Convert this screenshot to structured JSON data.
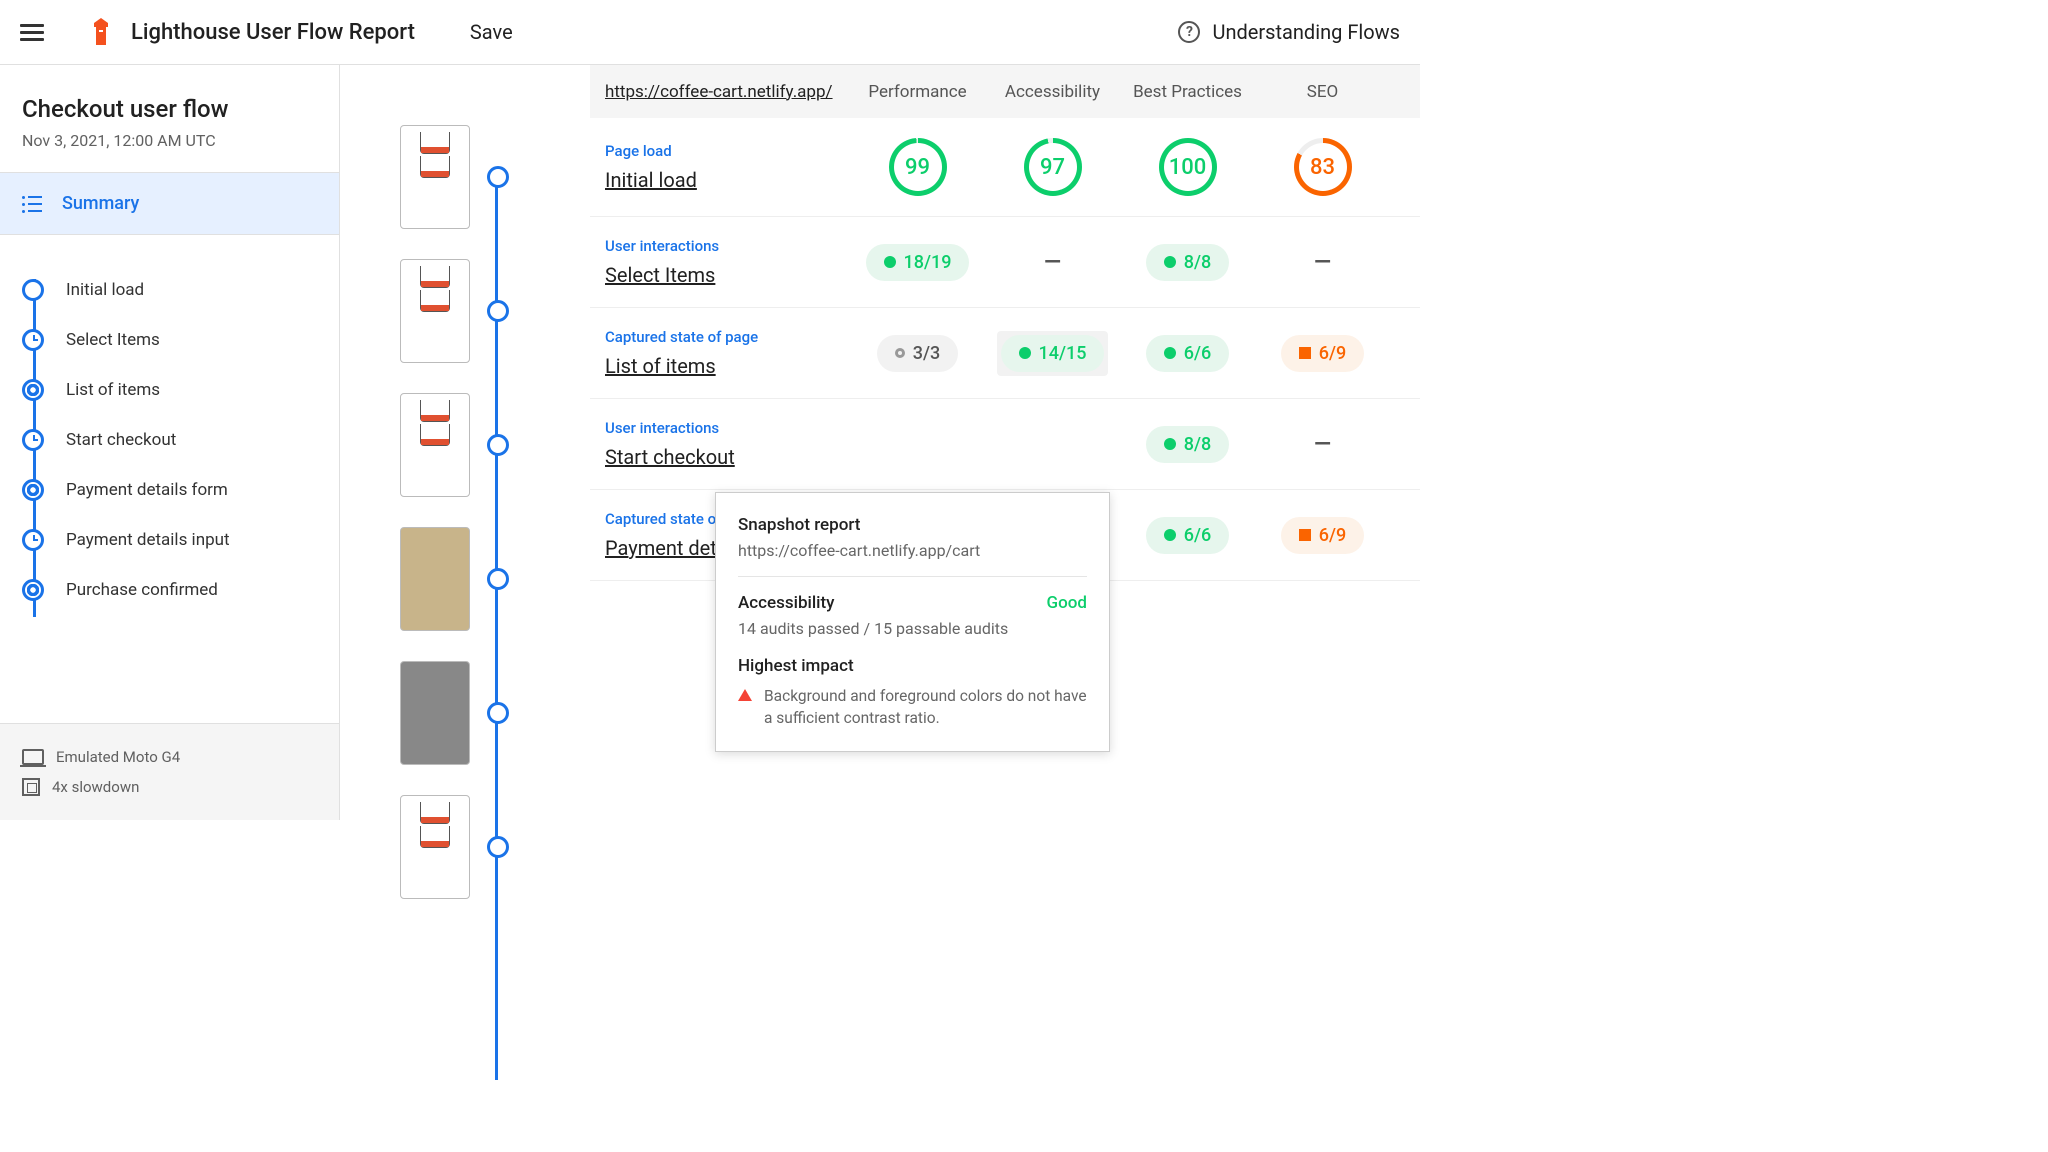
{
  "header": {
    "title": "Lighthouse User Flow Report",
    "save": "Save",
    "help": "Understanding Flows"
  },
  "sidebar": {
    "flow_title": "Checkout user flow",
    "date": "Nov 3, 2021, 12:00 AM UTC",
    "summary_label": "Summary",
    "steps": [
      {
        "label": "Initial load",
        "icon": "circle"
      },
      {
        "label": "Select Items",
        "icon": "timer"
      },
      {
        "label": "List of items",
        "icon": "aperture"
      },
      {
        "label": "Start checkout",
        "icon": "timer"
      },
      {
        "label": "Payment details form",
        "icon": "aperture"
      },
      {
        "label": "Payment details input",
        "icon": "timer"
      },
      {
        "label": "Purchase confirmed",
        "icon": "aperture"
      }
    ],
    "device": "Emulated Moto G4",
    "throttle": "4x slowdown"
  },
  "columns": {
    "url": "https://coffee-cart.netlify.app/",
    "perf": "Performance",
    "a11y": "Accessibility",
    "bp": "Best Practices",
    "seo": "SEO"
  },
  "rows": [
    {
      "type": "Page load",
      "title": "Initial load",
      "perf": {
        "kind": "gauge",
        "val": "99",
        "style": "gauge-green"
      },
      "a11y": {
        "kind": "gauge",
        "val": "97",
        "style": "gauge-green2"
      },
      "bp": {
        "kind": "gauge",
        "val": "100",
        "style": "gauge-green3"
      },
      "seo": {
        "kind": "gauge",
        "val": "83",
        "style": "gauge-orange"
      }
    },
    {
      "type": "User interactions",
      "title": "Select Items",
      "perf": {
        "kind": "pill",
        "val": "18/19",
        "cls": "green",
        "dot": "g"
      },
      "a11y": {
        "kind": "dash"
      },
      "bp": {
        "kind": "pill",
        "val": "8/8",
        "cls": "green",
        "dot": "g"
      },
      "seo": {
        "kind": "dash"
      }
    },
    {
      "type": "Captured state of page",
      "title": "List of items",
      "perf": {
        "kind": "pill",
        "val": "3/3",
        "cls": "gray",
        "dot": "gr"
      },
      "a11y": {
        "kind": "pill",
        "val": "14/15",
        "cls": "green",
        "dot": "g",
        "hl": true
      },
      "bp": {
        "kind": "pill",
        "val": "6/6",
        "cls": "green",
        "dot": "g"
      },
      "seo": {
        "kind": "pill",
        "val": "6/9",
        "cls": "orange",
        "sq": true
      }
    },
    {
      "type": "User interactions",
      "title": "Start checkout",
      "perf": {
        "kind": "hidden"
      },
      "a11y": {
        "kind": "hidden"
      },
      "bp": {
        "kind": "pill",
        "val": "8/8",
        "cls": "green",
        "dot": "g"
      },
      "seo": {
        "kind": "dash"
      }
    },
    {
      "type": "Captured state of page",
      "title": "Payment details form",
      "perf": {
        "kind": "hidden"
      },
      "a11y": {
        "kind": "hidden"
      },
      "bp": {
        "kind": "pill",
        "val": "6/6",
        "cls": "green",
        "dot": "g"
      },
      "seo": {
        "kind": "pill",
        "val": "6/9",
        "cls": "orange",
        "sq": true
      }
    }
  ],
  "tooltip": {
    "title": "Snapshot report",
    "url": "https://coffee-cart.netlify.app/cart",
    "category": "Accessibility",
    "rating": "Good",
    "detail": "14 audits passed / 15 passable audits",
    "impact_label": "Highest impact",
    "issue": "Background and foreground colors do not have a sufficient contrast ratio."
  },
  "thumbs": [
    "white",
    "white",
    "white",
    "tan",
    "dark",
    "white"
  ]
}
